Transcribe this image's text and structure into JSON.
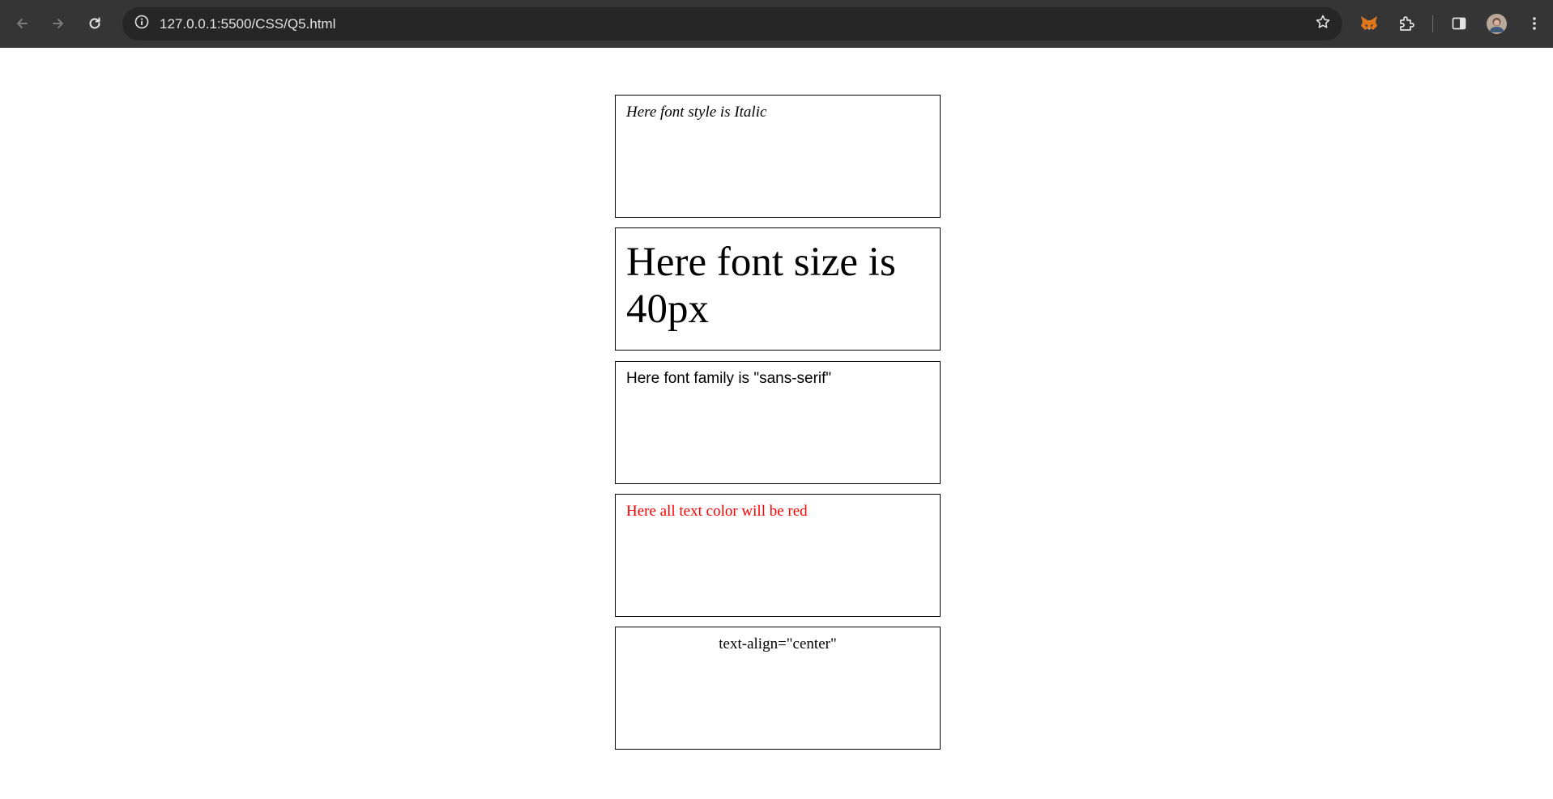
{
  "browser": {
    "url": "127.0.0.1:5500/CSS/Q5.html",
    "icons": {
      "back": "back-arrow-icon",
      "forward": "forward-arrow-icon",
      "reload": "reload-icon",
      "site_info": "info-icon",
      "bookmark": "star-icon",
      "extension_metamask": "fox-icon",
      "extensions": "puzzle-icon",
      "side_panel": "side-panel-icon",
      "profile": "avatar",
      "menu": "kebab-menu-icon"
    },
    "colors": {
      "toolbar": "#353535",
      "omnibox": "#262626",
      "url_text": "#e3e3e3"
    }
  },
  "page": {
    "boxes": [
      {
        "text": "Here font style is Italic"
      },
      {
        "text": "Here font size is 40px"
      },
      {
        "text": "Here font family is \"sans-serif\""
      },
      {
        "text": "Here all text color will be red",
        "color": "#ff0000"
      },
      {
        "text": "text-align=\"center\""
      }
    ]
  }
}
